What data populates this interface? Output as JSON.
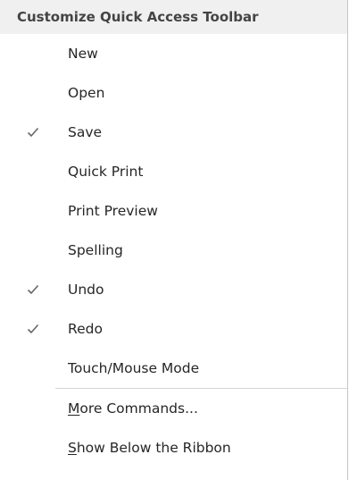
{
  "menu": {
    "header": "Customize Quick Access Toolbar",
    "check_color": "#666666",
    "items": [
      {
        "label": "New",
        "checked": false
      },
      {
        "label": "Open",
        "checked": false
      },
      {
        "label": "Save",
        "checked": true
      },
      {
        "label": "Quick Print",
        "checked": false
      },
      {
        "label": "Print Preview",
        "checked": false
      },
      {
        "label": "Spelling",
        "checked": false
      },
      {
        "label": "Undo",
        "checked": true
      },
      {
        "label": "Redo",
        "checked": true
      },
      {
        "label": "Touch/Mouse Mode",
        "checked": false
      }
    ],
    "actions": [
      {
        "mnemonic": "M",
        "rest": "ore Commands..."
      },
      {
        "mnemonic": "S",
        "rest": "how Below the Ribbon"
      }
    ]
  }
}
